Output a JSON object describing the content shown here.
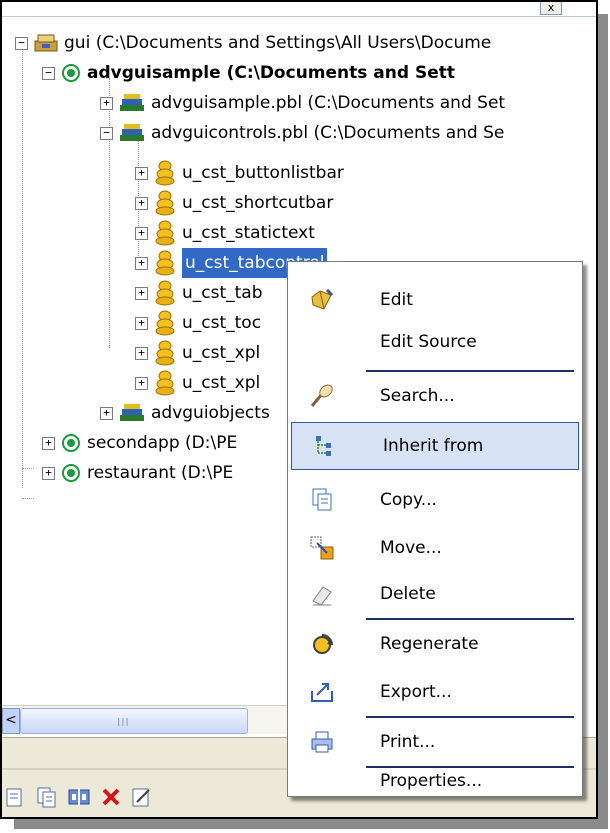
{
  "tree": {
    "nodes": [
      {
        "label": "gui (C:\\Documents and Settings\\All Users\\Docume",
        "expander": "−",
        "bold": false,
        "selected": false,
        "icon": "workspace-icon"
      },
      {
        "label": "advguisample (C:\\Documents and Sett",
        "expander": "−",
        "bold": true,
        "selected": false,
        "icon": "target-icon"
      },
      {
        "label": "advguisample.pbl (C:\\Documents and Set",
        "expander": "+",
        "bold": false,
        "selected": false,
        "icon": "library-icon"
      },
      {
        "label": "advguicontrols.pbl (C:\\Documents and Se",
        "expander": "−",
        "bold": false,
        "selected": false,
        "icon": "library-icon"
      },
      {
        "label": "u_cst_buttonlistbar",
        "expander": "+",
        "bold": false,
        "selected": false,
        "icon": "userobject-icon"
      },
      {
        "label": "u_cst_shortcutbar",
        "expander": "+",
        "bold": false,
        "selected": false,
        "icon": "userobject-icon"
      },
      {
        "label": "u_cst_statictext",
        "expander": "+",
        "bold": false,
        "selected": false,
        "icon": "userobject-icon"
      },
      {
        "label": "u_cst_tabcontrol",
        "expander": "+",
        "bold": false,
        "selected": true,
        "icon": "userobject-icon"
      },
      {
        "label": "u_cst_tab",
        "expander": "+",
        "bold": false,
        "selected": false,
        "icon": "userobject-icon"
      },
      {
        "label": "u_cst_toc",
        "expander": "+",
        "bold": false,
        "selected": false,
        "icon": "userobject-icon"
      },
      {
        "label": "u_cst_xpl",
        "expander": "+",
        "bold": false,
        "selected": false,
        "icon": "userobject-icon"
      },
      {
        "label": "u_cst_xpl",
        "expander": "+",
        "bold": false,
        "selected": false,
        "icon": "userobject-icon"
      },
      {
        "label": "advguiobjects",
        "expander": "+",
        "bold": false,
        "selected": false,
        "icon": "library-icon"
      },
      {
        "label": "secondapp (D:\\PE",
        "expander": "+",
        "bold": false,
        "selected": false,
        "icon": "target-icon"
      },
      {
        "label": "restaurant (D:\\PE",
        "expander": "+",
        "bold": false,
        "selected": false,
        "icon": "target-icon"
      }
    ]
  },
  "scroll": {
    "grip": "III",
    "left_arrow": "<",
    "top_arrow": "x"
  },
  "menu": {
    "items": [
      {
        "label": "Edit",
        "icon": "edit-icon"
      },
      {
        "label": "Edit Source",
        "icon": ""
      },
      {
        "label": "Search...",
        "icon": "search-icon"
      },
      {
        "label": "Inherit from",
        "icon": "inherit-icon"
      },
      {
        "label": "Copy...",
        "icon": "copy-icon"
      },
      {
        "label": "Move...",
        "icon": "move-icon"
      },
      {
        "label": "Delete",
        "icon": "delete-icon"
      },
      {
        "label": "Regenerate",
        "icon": "regenerate-icon"
      },
      {
        "label": "Export...",
        "icon": "export-icon"
      },
      {
        "label": "Print...",
        "icon": "print-icon"
      },
      {
        "label": "Properties...",
        "icon": ""
      }
    ],
    "hovered": "Inherit from"
  },
  "toolbar": {
    "buttons": [
      "copy-doc-icon",
      "paste-doc-icon",
      "split-icon",
      "delete-x-icon",
      "edit-doc-icon"
    ]
  },
  "colors": {
    "selection": "#316ac5",
    "menu_hover": "#d7e3f5",
    "menu_separator": "#1e2f6e"
  }
}
